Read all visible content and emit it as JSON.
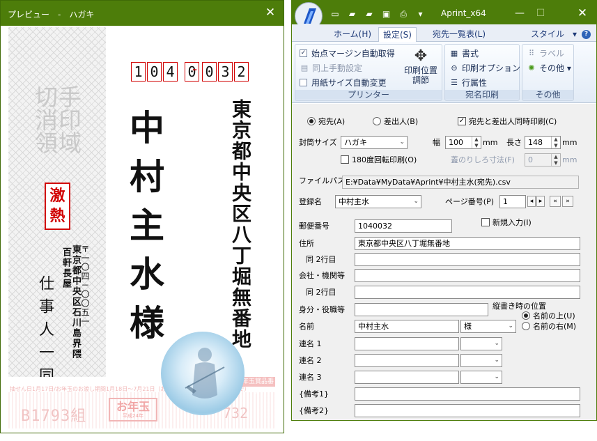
{
  "preview": {
    "title": "プレビュー　-　ハガキ",
    "close_glyph": "✕",
    "stamp_area_text": "切手消印領域",
    "to_zip_digits": [
      "1",
      "0",
      "4",
      "0",
      "0",
      "3",
      "2"
    ],
    "to_zip_dash": "-",
    "to_address": "東京都中央区八丁堀無番地",
    "to_name": "中村主水様",
    "stamp_text": "激熱",
    "from_zip": "〒一〇四－〇〇五一",
    "from_address1": "東京都中央区石川島界隈",
    "from_address2": "百軒長屋",
    "from_name": "仕事人一同",
    "lottery": {
      "fine_print": "抽せん日1月17日/お年玉のお渡し期間1月18日～7月21日（お年玉のお渡しは郵便局の窓口で）",
      "badge": "お年玉賞品番号",
      "number_left": "B1793組",
      "logo_main": "お年玉",
      "logo_sub": "平成24年",
      "number_right": "732"
    }
  },
  "app": {
    "title": "Aprint_x64",
    "quick_access": [
      "new-doc-icon",
      "open-folder-icon",
      "folder-icon",
      "save-icon",
      "print-icon",
      "qat-menu-icon"
    ],
    "window_controls": {
      "minimize": "—",
      "maximize": "☐",
      "close": "✕"
    },
    "tabs": {
      "home": "ホーム(H)",
      "settings": "設定(S)",
      "list": "宛先一覧表(L)"
    },
    "style_menu": "スタイル　▾",
    "help": "?",
    "ribbon": {
      "printer_group": {
        "label": "プリンター",
        "items": [
          {
            "label": "始点マージン自動取得",
            "checked": true
          },
          {
            "label": "同上手動設定",
            "disabled": true
          },
          {
            "label": "用紙サイズ自動変更",
            "checked": false
          }
        ],
        "adjust_label_1": "印刷位置",
        "adjust_label_2": "調節"
      },
      "address_group": {
        "label": "宛名印刷",
        "items": [
          "書式",
          "印刷オプション",
          "行属性"
        ]
      },
      "other_group": {
        "label": "その他",
        "items": [
          "ラベル",
          "その他 ▾"
        ]
      }
    },
    "form": {
      "radio_to": "宛先(A)",
      "radio_from": "差出人(B)",
      "simultaneous_print": "宛先と差出人同時印刷(C)",
      "envelope_size_label": "封筒サイズ",
      "envelope_size_value": "ハガキ",
      "width_label": "幅",
      "width_value": "100",
      "unit_mm": "mm",
      "length_label": "長さ",
      "length_value": "148",
      "rotate_print": "180度回転印刷(O)",
      "flap_label": "蓋のりしろ寸法(F)",
      "flap_value": "0",
      "file_path_label": "ファイルパス",
      "file_path_value": "E:¥Data¥MyData¥Aprint¥中村主水(宛先).csv",
      "registered_name_label": "登録名",
      "registered_name_value": "中村主水",
      "page_number_label": "ページ番号(P)",
      "page_number_value": "1",
      "zip_label": "郵便番号",
      "zip_value": "1040032",
      "new_entry": "新規入力(I)",
      "address_label": "住所",
      "address_value": "東京都中央区八丁堀無番地",
      "address2_label": "同 2行目",
      "company_label": "会社・機関等",
      "company2_label": "同 2行目",
      "position_label": "身分・役職等",
      "vertical_position_label": "縦書き時の位置",
      "radio_above_name": "名前の上(U)",
      "radio_right_of_name": "名前の右(M)",
      "name_label": "名前",
      "name_value": "中村主水",
      "honorific_value": "様",
      "joint1_label": "連名 1",
      "joint2_label": "連名 2",
      "joint3_label": "連名 3",
      "note1_label": "{備考1}",
      "note2_label": "{備考2}"
    }
  },
  "colors": {
    "titlebar_green": "#4d7d0a",
    "zip_box_red": "#d10000",
    "ribbon_text": "#1c2f55"
  }
}
